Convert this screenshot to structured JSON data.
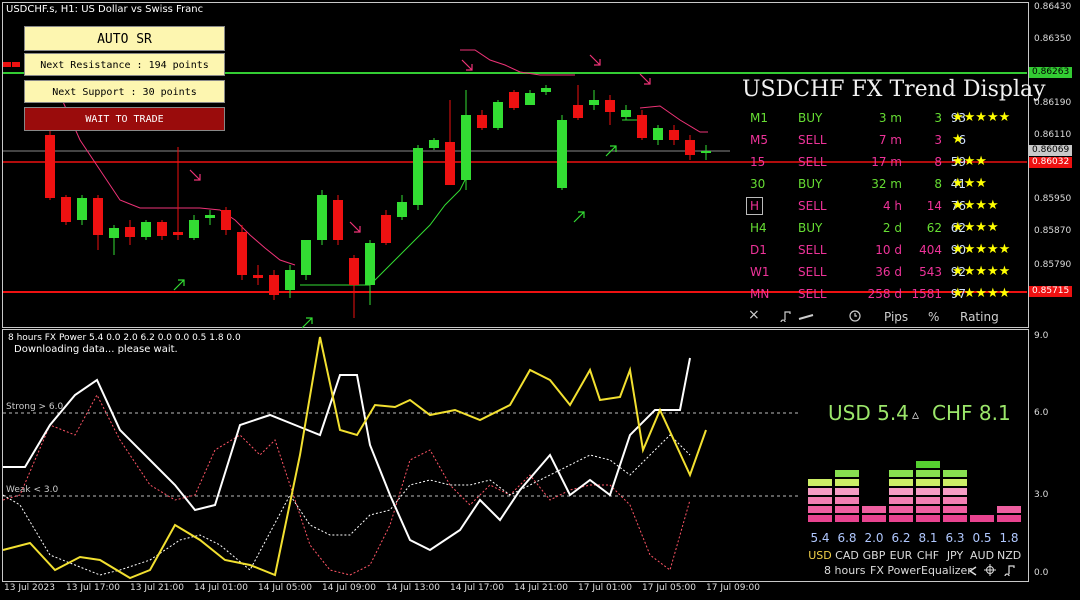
{
  "chart": {
    "title": "USDCHF.s, H1:  US Dollar vs Swiss Franc",
    "price_labels": [
      "0.86430",
      "0.86350",
      "0.86190",
      "0.86110",
      "0.85950",
      "0.85870",
      "0.85790"
    ],
    "resistance_tag": "0.86263",
    "current_tag": "0.86069",
    "bid_tag": "0.86032",
    "support_tag": "0.85715",
    "time_labels": [
      "13 Jul 2023",
      "13 Jul 17:00",
      "13 Jul 21:00",
      "14 Jul 01:00",
      "14 Jul 05:00",
      "14 Jul 09:00",
      "14 Jul 13:00",
      "14 Jul 17:00",
      "14 Jul 21:00",
      "17 Jul 01:00",
      "17 Jul 05:00",
      "17 Jul 09:00"
    ]
  },
  "auto_sr": {
    "title": "AUTO  SR",
    "next_resistance": "Next Resistance : 194 points",
    "next_support": "Next Support : 30 points",
    "status": "WAIT TO TRADE"
  },
  "trend_display": {
    "title": "USDCHF FX Trend Display",
    "rows": [
      {
        "tf": "M1",
        "dir": "BUY",
        "dur": "3 m",
        "pips": "3",
        "pct": "93",
        "stars": "★★★★★"
      },
      {
        "tf": "M5",
        "dir": "SELL",
        "dur": "7 m",
        "pips": "3",
        "pct": "6",
        "stars": "★"
      },
      {
        "tf": "15",
        "dir": "SELL",
        "dur": "17 m",
        "pips": "8",
        "pct": "59",
        "stars": "★★★"
      },
      {
        "tf": "30",
        "dir": "BUY",
        "dur": "32 m",
        "pips": "8",
        "pct": "41",
        "stars": "★★★"
      },
      {
        "tf": "H",
        "dir": "SELL",
        "dur": "4 h",
        "pips": "14",
        "pct": "76",
        "stars": "★★★★"
      },
      {
        "tf": "H4",
        "dir": "BUY",
        "dur": "2 d",
        "pips": "62",
        "pct": "62",
        "stars": "★★★★"
      },
      {
        "tf": "D1",
        "dir": "SELL",
        "dur": "10 d",
        "pips": "404",
        "pct": "90",
        "stars": "★★★★★"
      },
      {
        "tf": "W1",
        "dir": "SELL",
        "dur": "36 d",
        "pips": "543",
        "pct": "92",
        "stars": "★★★★★"
      },
      {
        "tf": "MN",
        "dir": "SELL",
        "dur": "258 d",
        "pips": "1581",
        "pct": "97",
        "stars": "★★★★★"
      }
    ],
    "header": {
      "close": "×",
      "pips": "Pips",
      "pct": "%",
      "rating": "Rating"
    }
  },
  "fx_power": {
    "title": "8 hours FX Power 5.4 0.0 2.0 6.2 0.0 0.0 0.5 1.8 0.0",
    "status": "Downloading data... please wait.",
    "strong_label": "Strong > 6.0",
    "weak_label": "Weak < 3.0",
    "scale": [
      "9.0",
      "6.0",
      "3.0",
      "0.0"
    ],
    "usd": "USD 5.4",
    "delta": "▵",
    "chf": "CHF 8.1",
    "currencies": [
      {
        "name": "USD",
        "value": "5.4",
        "level": 5,
        "color": "#f2d14a"
      },
      {
        "name": "CAD",
        "value": "6.8",
        "level": 6,
        "color": "#dcdcdc"
      },
      {
        "name": "GBP",
        "value": "2.0",
        "level": 2,
        "color": "#dcdcdc"
      },
      {
        "name": "EUR",
        "value": "6.2",
        "level": 6,
        "color": "#dcdcdc"
      },
      {
        "name": "CHF",
        "value": "8.1",
        "level": 7,
        "color": "#dcdcdc"
      },
      {
        "name": "JPY",
        "value": "6.3",
        "level": 6,
        "color": "#dcdcdc"
      },
      {
        "name": "AUD",
        "value": "0.5",
        "level": 1,
        "color": "#dcdcdc"
      },
      {
        "name": "NZD",
        "value": "1.8",
        "level": 2,
        "color": "#dcdcdc"
      }
    ],
    "footer": {
      "period": "8 hours",
      "name": "FX Power",
      "eq": "Equalizer"
    }
  },
  "colors": {
    "bull": "#33dd33",
    "bear": "#ee1111",
    "resistance": "#33cc33",
    "support": "#ee1111",
    "usd_line": "#ffffff",
    "chf_line": "#f2e030"
  }
}
